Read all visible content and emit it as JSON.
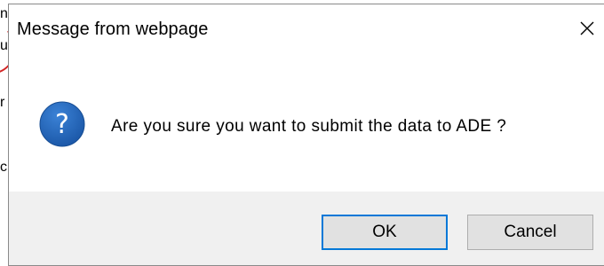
{
  "background": {
    "fragments": [
      "n",
      "us",
      "r",
      "c"
    ]
  },
  "dialog": {
    "title": "Message from webpage",
    "close_icon": "close-icon",
    "icon": "question-icon",
    "message": "Are you sure you want to submit the data to ADE ?",
    "buttons": {
      "ok_label": "OK",
      "cancel_label": "Cancel"
    },
    "colors": {
      "icon_blue": "#1f5fb0",
      "ok_border": "#0078d7",
      "footer_bg": "#f0f0f0",
      "button_bg": "#e1e1e1"
    }
  }
}
